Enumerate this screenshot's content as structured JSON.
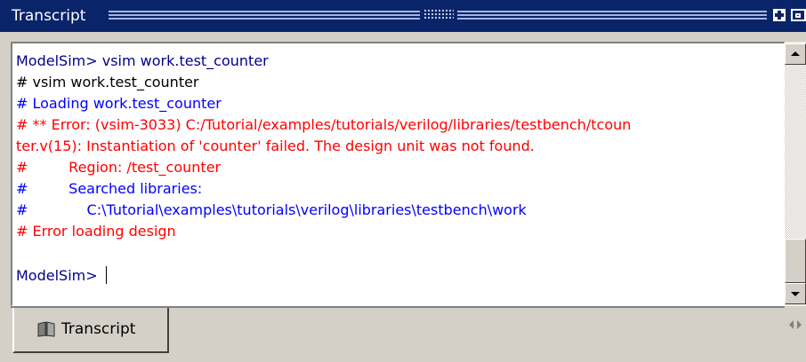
{
  "window": {
    "title": "Transcript"
  },
  "colors": {
    "prompt": "#00008b",
    "echo": "#000000",
    "info": "#0000ff",
    "error": "#ff0000",
    "titlebar": "#0a246a"
  },
  "transcript": {
    "lines": [
      "ModelSim> vsim work.test_counter",
      "# vsim work.test_counter",
      "# Loading work.test_counter",
      "# ** Error: (vsim-3033) C:/Tutorial/examples/tutorials/verilog/libraries/testbench/tcoun",
      "ter.v(15): Instantiation of 'counter' failed. The design unit was not found.",
      "#         Region: /test_counter",
      "#         Searched libraries:",
      "#             C:\\Tutorial\\examples\\tutorials\\verilog\\libraries\\testbench\\work",
      "# Error loading design"
    ],
    "prompt": "ModelSim> "
  },
  "tabs": {
    "active_label": "Transcript",
    "icon": "transcript-book-icon"
  },
  "icons": {
    "maximize": "plus-icon",
    "undock": "undock-icon",
    "scroll_up": "arrow-up-icon",
    "scroll_down": "arrow-down-icon",
    "tab_prev": "arrow-left-icon",
    "tab_next": "arrow-right-icon"
  }
}
